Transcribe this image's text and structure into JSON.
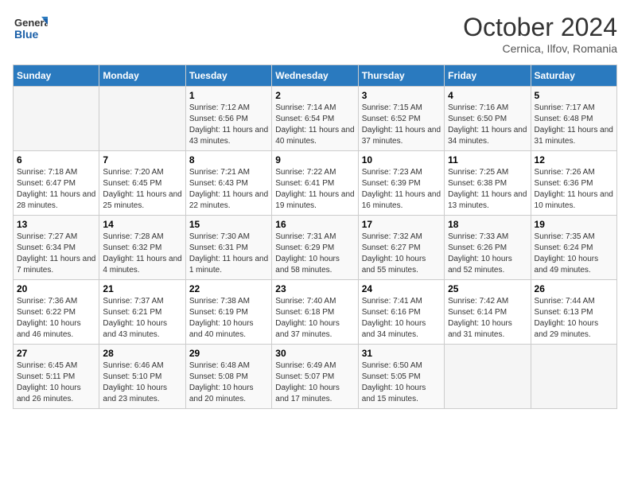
{
  "header": {
    "logo_line1": "General",
    "logo_line2": "Blue",
    "month": "October 2024",
    "location": "Cernica, Ilfov, Romania"
  },
  "columns": [
    "Sunday",
    "Monday",
    "Tuesday",
    "Wednesday",
    "Thursday",
    "Friday",
    "Saturday"
  ],
  "weeks": [
    [
      {
        "day": "",
        "info": ""
      },
      {
        "day": "",
        "info": ""
      },
      {
        "day": "1",
        "info": "Sunrise: 7:12 AM\nSunset: 6:56 PM\nDaylight: 11 hours and 43 minutes."
      },
      {
        "day": "2",
        "info": "Sunrise: 7:14 AM\nSunset: 6:54 PM\nDaylight: 11 hours and 40 minutes."
      },
      {
        "day": "3",
        "info": "Sunrise: 7:15 AM\nSunset: 6:52 PM\nDaylight: 11 hours and 37 minutes."
      },
      {
        "day": "4",
        "info": "Sunrise: 7:16 AM\nSunset: 6:50 PM\nDaylight: 11 hours and 34 minutes."
      },
      {
        "day": "5",
        "info": "Sunrise: 7:17 AM\nSunset: 6:48 PM\nDaylight: 11 hours and 31 minutes."
      }
    ],
    [
      {
        "day": "6",
        "info": "Sunrise: 7:18 AM\nSunset: 6:47 PM\nDaylight: 11 hours and 28 minutes."
      },
      {
        "day": "7",
        "info": "Sunrise: 7:20 AM\nSunset: 6:45 PM\nDaylight: 11 hours and 25 minutes."
      },
      {
        "day": "8",
        "info": "Sunrise: 7:21 AM\nSunset: 6:43 PM\nDaylight: 11 hours and 22 minutes."
      },
      {
        "day": "9",
        "info": "Sunrise: 7:22 AM\nSunset: 6:41 PM\nDaylight: 11 hours and 19 minutes."
      },
      {
        "day": "10",
        "info": "Sunrise: 7:23 AM\nSunset: 6:39 PM\nDaylight: 11 hours and 16 minutes."
      },
      {
        "day": "11",
        "info": "Sunrise: 7:25 AM\nSunset: 6:38 PM\nDaylight: 11 hours and 13 minutes."
      },
      {
        "day": "12",
        "info": "Sunrise: 7:26 AM\nSunset: 6:36 PM\nDaylight: 11 hours and 10 minutes."
      }
    ],
    [
      {
        "day": "13",
        "info": "Sunrise: 7:27 AM\nSunset: 6:34 PM\nDaylight: 11 hours and 7 minutes."
      },
      {
        "day": "14",
        "info": "Sunrise: 7:28 AM\nSunset: 6:32 PM\nDaylight: 11 hours and 4 minutes."
      },
      {
        "day": "15",
        "info": "Sunrise: 7:30 AM\nSunset: 6:31 PM\nDaylight: 11 hours and 1 minute."
      },
      {
        "day": "16",
        "info": "Sunrise: 7:31 AM\nSunset: 6:29 PM\nDaylight: 10 hours and 58 minutes."
      },
      {
        "day": "17",
        "info": "Sunrise: 7:32 AM\nSunset: 6:27 PM\nDaylight: 10 hours and 55 minutes."
      },
      {
        "day": "18",
        "info": "Sunrise: 7:33 AM\nSunset: 6:26 PM\nDaylight: 10 hours and 52 minutes."
      },
      {
        "day": "19",
        "info": "Sunrise: 7:35 AM\nSunset: 6:24 PM\nDaylight: 10 hours and 49 minutes."
      }
    ],
    [
      {
        "day": "20",
        "info": "Sunrise: 7:36 AM\nSunset: 6:22 PM\nDaylight: 10 hours and 46 minutes."
      },
      {
        "day": "21",
        "info": "Sunrise: 7:37 AM\nSunset: 6:21 PM\nDaylight: 10 hours and 43 minutes."
      },
      {
        "day": "22",
        "info": "Sunrise: 7:38 AM\nSunset: 6:19 PM\nDaylight: 10 hours and 40 minutes."
      },
      {
        "day": "23",
        "info": "Sunrise: 7:40 AM\nSunset: 6:18 PM\nDaylight: 10 hours and 37 minutes."
      },
      {
        "day": "24",
        "info": "Sunrise: 7:41 AM\nSunset: 6:16 PM\nDaylight: 10 hours and 34 minutes."
      },
      {
        "day": "25",
        "info": "Sunrise: 7:42 AM\nSunset: 6:14 PM\nDaylight: 10 hours and 31 minutes."
      },
      {
        "day": "26",
        "info": "Sunrise: 7:44 AM\nSunset: 6:13 PM\nDaylight: 10 hours and 29 minutes."
      }
    ],
    [
      {
        "day": "27",
        "info": "Sunrise: 6:45 AM\nSunset: 5:11 PM\nDaylight: 10 hours and 26 minutes."
      },
      {
        "day": "28",
        "info": "Sunrise: 6:46 AM\nSunset: 5:10 PM\nDaylight: 10 hours and 23 minutes."
      },
      {
        "day": "29",
        "info": "Sunrise: 6:48 AM\nSunset: 5:08 PM\nDaylight: 10 hours and 20 minutes."
      },
      {
        "day": "30",
        "info": "Sunrise: 6:49 AM\nSunset: 5:07 PM\nDaylight: 10 hours and 17 minutes."
      },
      {
        "day": "31",
        "info": "Sunrise: 6:50 AM\nSunset: 5:05 PM\nDaylight: 10 hours and 15 minutes."
      },
      {
        "day": "",
        "info": ""
      },
      {
        "day": "",
        "info": ""
      }
    ]
  ]
}
